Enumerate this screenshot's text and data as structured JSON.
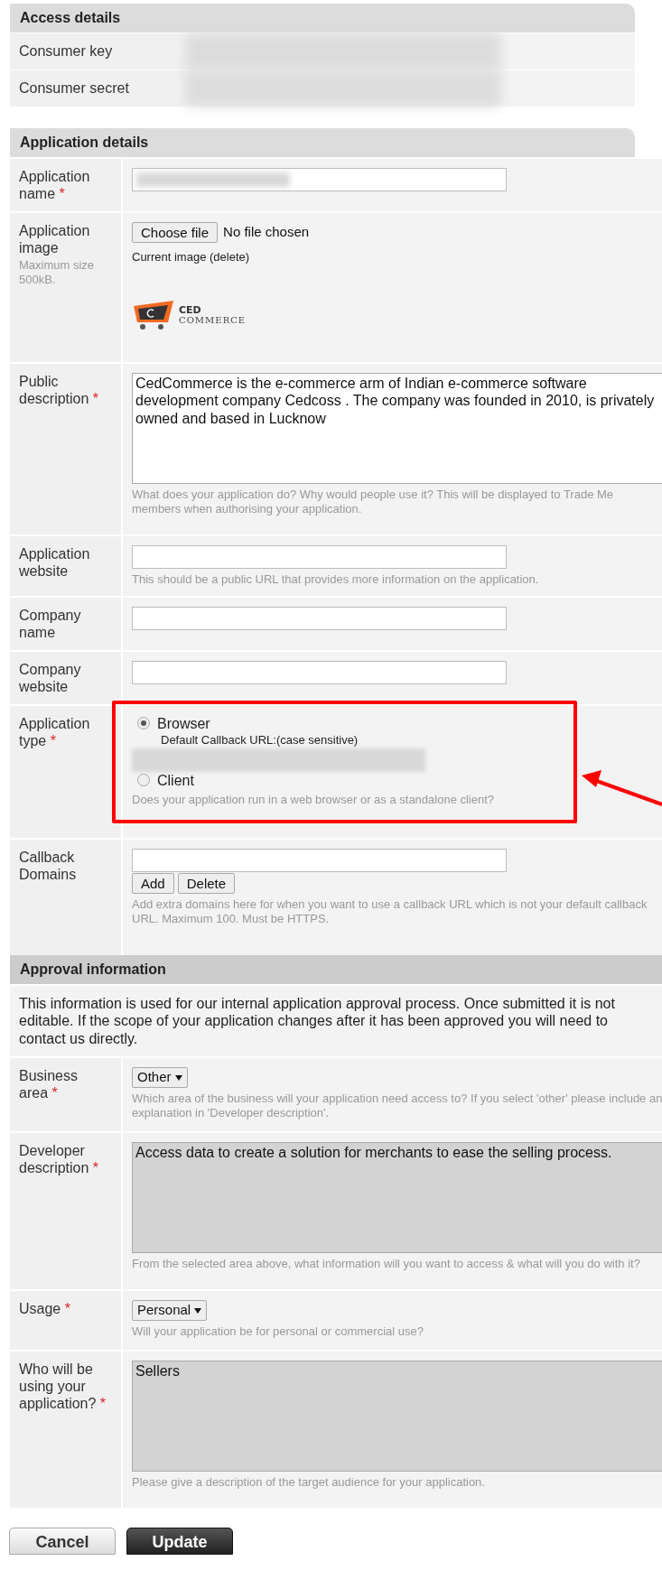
{
  "access_details": {
    "title": "Access details",
    "rows": [
      {
        "label": "Consumer key"
      },
      {
        "label": "Consumer secret"
      }
    ]
  },
  "application_details": {
    "title": "Application details",
    "fields": [
      {
        "kind": "text_redacted",
        "label": "Application name",
        "marker": "*"
      },
      {
        "kind": "file",
        "label": "Application image",
        "note": "Maximum size 500kB.",
        "button": "Choose file",
        "status": "No file chosen",
        "current": "Current image (delete)",
        "logo": {
          "line1": "CED",
          "line2": "COMMERCE"
        }
      },
      {
        "kind": "textarea",
        "label": "Public description",
        "marker": "*",
        "readonly": false,
        "value": "CedCommerce is the e-commerce arm of Indian e-commerce software development company Cedcoss . The company was founded in 2010, is privately owned and based in Lucknow",
        "hint": "What does your application do? Why would people use it? This will be displayed to Trade Me members when authorising your application."
      },
      {
        "kind": "text",
        "label": "Application website",
        "hint": "This should be a public URL that provides more information on the application."
      },
      {
        "kind": "text",
        "label": "Company name"
      },
      {
        "kind": "text",
        "label": "Company website"
      },
      {
        "kind": "radio",
        "label": "Application type",
        "marker": "*",
        "options": [
          {
            "label": "Browser",
            "selected": true,
            "sub": "Default Callback URL:(case sensitive)"
          },
          {
            "label": "Client",
            "selected": false
          }
        ],
        "hint": "Does your application run in a web browser or as a standalone client?"
      },
      {
        "kind": "domains",
        "label": "Callback Domains",
        "buttons": [
          "Add",
          "Delete"
        ],
        "hint": "Add extra domains here for when you want to use a callback URL which is not your default callback URL. Maximum 100. Must be HTTPS."
      }
    ]
  },
  "approval_information": {
    "title": "Approval information",
    "intro": "This information is used for our internal application approval process. Once submitted it is not editable. If the scope of your application changes after it has been approved you will need to contact us directly.",
    "fields": [
      {
        "kind": "select",
        "label": "Business area",
        "marker": "*",
        "value": "Other",
        "hint": "Which area of the business will your application need access to? If you select 'other' please include an explanation in 'Developer description'."
      },
      {
        "kind": "textarea",
        "label": "Developer description",
        "marker": "*",
        "readonly": true,
        "value": "Access data to create a solution for merchants to ease the selling process.",
        "hint": "From the selected area above, what information will you want to access & what will you do with it?"
      },
      {
        "kind": "select",
        "label": "Usage",
        "marker": "*",
        "value": "Personal",
        "hint": "Will your application be for personal or commercial use?"
      },
      {
        "kind": "textarea",
        "label": "Who will be using your application?",
        "marker": "*",
        "readonly": true,
        "value": "Sellers",
        "hint": "Please give a description of the target audience for your application."
      }
    ]
  },
  "buttons": [
    {
      "label": "Cancel",
      "kind": "secondary"
    },
    {
      "label": "Update",
      "kind": "primary"
    }
  ]
}
